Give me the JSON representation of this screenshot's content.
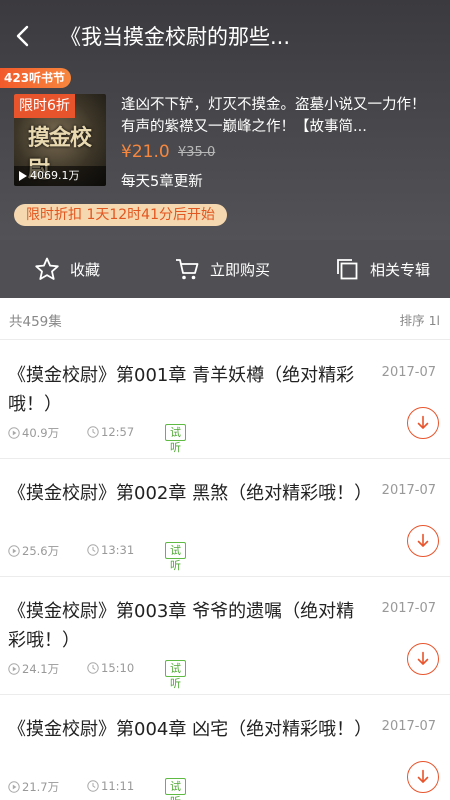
{
  "header": {
    "title": "《我当摸金校尉的那些...",
    "promo_tag": "423听书节",
    "cover": {
      "badge": "限时6折",
      "art_text": "摸金校尉",
      "plays": "4069.1万"
    },
    "description": "逢凶不下铲，灯灭不摸金。盗墓小说又一力作！有声的紫襟又一巅峰之作！【故事简...",
    "price_now": "¥21.0",
    "price_old": "¥35.0",
    "update_info": "每天5章更新",
    "discount_countdown": "限时折扣 1天12时41分后开始"
  },
  "actions": {
    "collect": "收藏",
    "buy": "立即购买",
    "related": "相关专辑"
  },
  "list": {
    "count": "共459集",
    "sort_label": "排序 1l",
    "trial_label": "试听",
    "episodes": [
      {
        "title": "《摸金校尉》第001章 青羊妖樽（绝对精彩哦！）",
        "date": "2017-07",
        "plays": "40.9万",
        "duration": "12:57"
      },
      {
        "title": "《摸金校尉》第002章 黑煞（绝对精彩哦！）",
        "date": "2017-07",
        "plays": "25.6万",
        "duration": "13:31"
      },
      {
        "title": "《摸金校尉》第003章 爷爷的遗嘱（绝对精彩哦！）",
        "date": "2017-07",
        "plays": "24.1万",
        "duration": "15:10"
      },
      {
        "title": "《摸金校尉》第004章 凶宅（绝对精彩哦！）",
        "date": "2017-07",
        "plays": "21.7万",
        "duration": "11:11"
      }
    ]
  },
  "colors": {
    "accent": "#e8552d",
    "price": "#f7873e",
    "trial": "#5fba43",
    "header_bg": "#3b3a3e"
  },
  "icons": {
    "back": "chevron-left-icon",
    "collect": "star-outline-icon",
    "buy": "cart-icon",
    "related": "copy-icon",
    "plays": "play-circle-icon",
    "duration": "clock-icon",
    "download": "download-arrow-icon"
  }
}
